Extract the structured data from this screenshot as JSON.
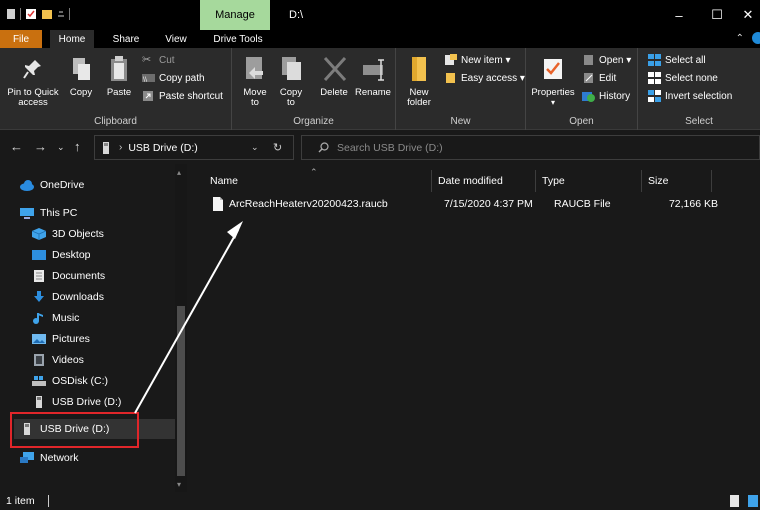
{
  "window": {
    "title": "D:\\",
    "context_tab": "Manage",
    "controls": {
      "minimize": "–",
      "maximize": "☐",
      "close": "✕"
    }
  },
  "ribbon_tabs": [
    "File",
    "Home",
    "Share",
    "View",
    "Drive Tools"
  ],
  "ribbon": {
    "clipboard": {
      "label": "Clipboard",
      "pin": "Pin to Quick access",
      "copy": "Copy",
      "paste": "Paste",
      "cut": "Cut",
      "copy_path": "Copy path",
      "paste_shortcut": "Paste shortcut"
    },
    "organize": {
      "label": "Organize",
      "move_to": "Move to",
      "copy_to": "Copy to",
      "delete": "Delete",
      "rename": "Rename"
    },
    "new": {
      "label": "New",
      "new_folder": "New folder",
      "new_item": "New item ▾",
      "easy_access": "Easy access ▾"
    },
    "open": {
      "label": "Open",
      "properties": "Properties",
      "open": "Open ▾",
      "edit": "Edit",
      "history": "History"
    },
    "select": {
      "label": "Select",
      "select_all": "Select all",
      "select_none": "Select none",
      "invert_selection": "Invert selection"
    }
  },
  "address": {
    "path": "USB Drive (D:)",
    "search_placeholder": "Search USB Drive (D:)"
  },
  "nav_pane": {
    "items": [
      {
        "label": "OneDrive",
        "icon": "cloud-icon"
      },
      {
        "label": "This PC",
        "icon": "pc-icon"
      },
      {
        "label": "3D Objects",
        "icon": "cube-icon"
      },
      {
        "label": "Desktop",
        "icon": "desktop-icon"
      },
      {
        "label": "Documents",
        "icon": "documents-icon"
      },
      {
        "label": "Downloads",
        "icon": "download-icon"
      },
      {
        "label": "Music",
        "icon": "music-icon"
      },
      {
        "label": "Pictures",
        "icon": "pictures-icon"
      },
      {
        "label": "Videos",
        "icon": "videos-icon"
      },
      {
        "label": "OSDisk (C:)",
        "icon": "drive-icon"
      },
      {
        "label": "USB Drive (D:)",
        "icon": "usb-drive-icon"
      },
      {
        "label": "USB Drive (D:)",
        "icon": "usb-drive-icon"
      },
      {
        "label": "Network",
        "icon": "network-icon"
      }
    ]
  },
  "file_list": {
    "columns": [
      "Name",
      "Date modified",
      "Type",
      "Size"
    ],
    "rows": [
      {
        "name": "ArcReachHeaterv20200423.raucb",
        "date": "7/15/2020 4:37 PM",
        "type": "RAUCB File",
        "size": "72,166 KB"
      }
    ]
  },
  "status": {
    "item_count": "1 item"
  },
  "colors": {
    "accent_file_tab": "#c9700f",
    "manage_tab": "#a6d99c",
    "annotation_red": "#e0262a"
  }
}
